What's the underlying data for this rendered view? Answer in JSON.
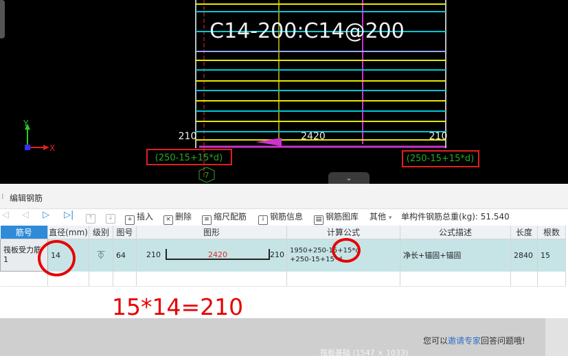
{
  "drawing": {
    "rebar_label": "C14-200:C14@200",
    "dim_left": "210",
    "dim_middle": "2420",
    "dim_right": "210",
    "formula_left": "(250-15+15*d)",
    "formula_right": "(250-15+15*d)",
    "axis_number": "7",
    "axis_x": "X",
    "axis_y": "Y",
    "collapse_glyph": "⌄"
  },
  "panel": {
    "title": "编辑钢筋",
    "toolbar": {
      "first": "◁",
      "prev": "◁",
      "next": "▷",
      "last": "▷|",
      "insert": "插入",
      "delete": "删除",
      "scale": "缩尺配筋",
      "info": "钢筋信息",
      "library": "钢筋图库",
      "other": "其他",
      "weight_label": "单构件钢筋总重(kg): 51.540"
    },
    "columns": [
      "筋号",
      "直径(mm)",
      "级别",
      "图号",
      "图形",
      "计算公式",
      "公式描述",
      "长度",
      "根数"
    ],
    "row": {
      "name_line1": "筏板受力筋",
      "name_line2": "1",
      "diameter": "14",
      "grade": "⏁",
      "figure_no": "64",
      "shape_left": "210",
      "shape_mid": "2420",
      "shape_right": "210",
      "formula_line1": "1950+250-15+15*d",
      "formula_line2": "+250-15+15*d",
      "description": "净长+锚固+锚固",
      "length": "2840",
      "count": "15"
    }
  },
  "annotation": "15*14=210",
  "footer": {
    "ask_prefix": "您可以",
    "ask_link": "邀请专家",
    "ask_suffix": "回答问题哦!",
    "caption": "筏板基础 (1547 × 1033)"
  },
  "colors": {
    "cad_background": "#000000",
    "highlight_red": "#e60000",
    "accent_blue": "#2f8ad8",
    "row_selected": "#c6e4e6"
  }
}
